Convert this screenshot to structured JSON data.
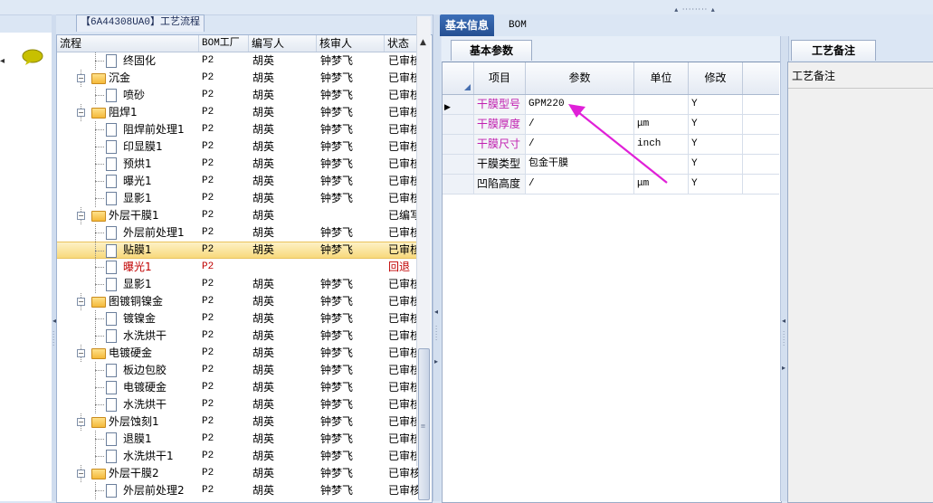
{
  "process_group": {
    "title": "【6A44308UA0】工艺流程",
    "columns": [
      "流程",
      "BOM工厂",
      "编写人",
      "核审人",
      "状态"
    ],
    "rows": [
      {
        "level": 1,
        "type": "doc",
        "name": "终固化",
        "bom": "P2",
        "writer": "胡英",
        "auditor": "钟梦飞",
        "status": "已审核"
      },
      {
        "level": 0,
        "type": "folder",
        "name": "沉金",
        "bom": "P2",
        "writer": "胡英",
        "auditor": "钟梦飞",
        "status": "已审核"
      },
      {
        "level": 1,
        "type": "doc",
        "name": "喷砂",
        "bom": "P2",
        "writer": "胡英",
        "auditor": "钟梦飞",
        "status": "已审核"
      },
      {
        "level": 0,
        "type": "folder",
        "name": "阻焊1",
        "bom": "P2",
        "writer": "胡英",
        "auditor": "钟梦飞",
        "status": "已审核"
      },
      {
        "level": 1,
        "type": "doc",
        "name": "阻焊前处理1",
        "bom": "P2",
        "writer": "胡英",
        "auditor": "钟梦飞",
        "status": "已审核"
      },
      {
        "level": 1,
        "type": "doc",
        "name": "印显膜1",
        "bom": "P2",
        "writer": "胡英",
        "auditor": "钟梦飞",
        "status": "已审核"
      },
      {
        "level": 1,
        "type": "doc",
        "name": "预烘1",
        "bom": "P2",
        "writer": "胡英",
        "auditor": "钟梦飞",
        "status": "已审核"
      },
      {
        "level": 1,
        "type": "doc",
        "name": "曝光1",
        "bom": "P2",
        "writer": "胡英",
        "auditor": "钟梦飞",
        "status": "已审核"
      },
      {
        "level": 1,
        "type": "doc",
        "name": "显影1",
        "bom": "P2",
        "writer": "胡英",
        "auditor": "钟梦飞",
        "status": "已审核"
      },
      {
        "level": 0,
        "type": "folder",
        "name": "外层干膜1",
        "bom": "P2",
        "writer": "胡英",
        "auditor": "",
        "status": "已编写"
      },
      {
        "level": 1,
        "type": "doc",
        "name": "外层前处理1",
        "bom": "P2",
        "writer": "胡英",
        "auditor": "钟梦飞",
        "status": "已审核"
      },
      {
        "level": 1,
        "type": "doc",
        "name": "贴膜1",
        "bom": "P2",
        "writer": "胡英",
        "auditor": "钟梦飞",
        "status": "已审核",
        "selected": true
      },
      {
        "level": 1,
        "type": "doc",
        "name": "曝光1",
        "bom": "P2",
        "writer": "",
        "auditor": "",
        "status": "回退",
        "red": true
      },
      {
        "level": 1,
        "type": "doc",
        "name": "显影1",
        "bom": "P2",
        "writer": "胡英",
        "auditor": "钟梦飞",
        "status": "已审核"
      },
      {
        "level": 0,
        "type": "folder",
        "name": "图镀铜镍金",
        "bom": "P2",
        "writer": "胡英",
        "auditor": "钟梦飞",
        "status": "已审核"
      },
      {
        "level": 1,
        "type": "doc",
        "name": "镀镍金",
        "bom": "P2",
        "writer": "胡英",
        "auditor": "钟梦飞",
        "status": "已审核"
      },
      {
        "level": 1,
        "type": "doc",
        "name": "水洗烘干",
        "bom": "P2",
        "writer": "胡英",
        "auditor": "钟梦飞",
        "status": "已审核"
      },
      {
        "level": 0,
        "type": "folder",
        "name": "电镀硬金",
        "bom": "P2",
        "writer": "胡英",
        "auditor": "钟梦飞",
        "status": "已审核"
      },
      {
        "level": 1,
        "type": "doc",
        "name": "板边包胶",
        "bom": "P2",
        "writer": "胡英",
        "auditor": "钟梦飞",
        "status": "已审核"
      },
      {
        "level": 1,
        "type": "doc",
        "name": "电镀硬金",
        "bom": "P2",
        "writer": "胡英",
        "auditor": "钟梦飞",
        "status": "已审核"
      },
      {
        "level": 1,
        "type": "doc",
        "name": "水洗烘干",
        "bom": "P2",
        "writer": "胡英",
        "auditor": "钟梦飞",
        "status": "已审核"
      },
      {
        "level": 0,
        "type": "folder",
        "name": "外层蚀刻1",
        "bom": "P2",
        "writer": "胡英",
        "auditor": "钟梦飞",
        "status": "已审核"
      },
      {
        "level": 1,
        "type": "doc",
        "name": "退膜1",
        "bom": "P2",
        "writer": "胡英",
        "auditor": "钟梦飞",
        "status": "已审核"
      },
      {
        "level": 1,
        "type": "doc",
        "name": "水洗烘干1",
        "bom": "P2",
        "writer": "胡英",
        "auditor": "钟梦飞",
        "status": "已审核"
      },
      {
        "level": 0,
        "type": "folder",
        "name": "外层干膜2",
        "bom": "P2",
        "writer": "胡英",
        "auditor": "钟梦飞",
        "status": "已审核"
      },
      {
        "level": 1,
        "type": "doc",
        "name": "外层前处理2",
        "bom": "P2",
        "writer": "胡英",
        "auditor": "钟梦飞",
        "status": "已审核"
      }
    ]
  },
  "tabs": {
    "basic": "基本信息",
    "bom": "BOM"
  },
  "param_panel": {
    "tab": "基本参数",
    "columns": [
      "项目",
      "参数",
      "单位",
      "修改"
    ],
    "rows": [
      {
        "item": "干膜型号",
        "param": "GPM220",
        "unit": "",
        "mod": "Y",
        "magenta": true
      },
      {
        "item": "干膜厚度",
        "param": "/",
        "unit": "μm",
        "mod": "Y",
        "magenta": true
      },
      {
        "item": "干膜尺寸",
        "param": "/",
        "unit": "inch",
        "mod": "Y",
        "magenta": true
      },
      {
        "item": "干膜类型",
        "param": "包金干膜",
        "unit": "",
        "mod": "Y",
        "magenta": false
      },
      {
        "item": "凹陷高度",
        "param": "/",
        "unit": "μm",
        "mod": "Y",
        "magenta": false
      }
    ]
  },
  "note_panel": {
    "tab": "工艺备注",
    "label": "工艺备注"
  },
  "colors": {
    "accent_tab": "#2f5fa8",
    "annotation_arrow": "#e020d8",
    "selected_row": "#f8d97c",
    "rollback_red": "#c00000"
  }
}
